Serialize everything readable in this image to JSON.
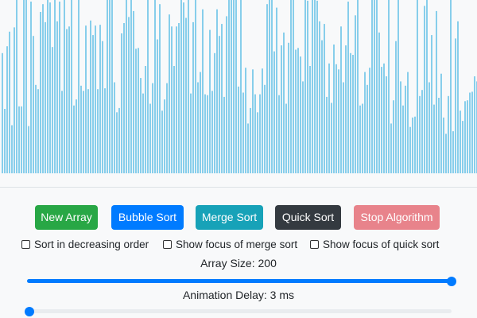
{
  "colors": {
    "bar": "#87ceeb",
    "new_array": "#28a745",
    "bubble_sort": "#007bff",
    "merge_sort": "#17a2b8",
    "quick_sort": "#343a40",
    "stop_algorithm": "#e8838b",
    "slider_fill": "#007bff",
    "slider_track": "#e9ecef"
  },
  "array": {
    "max_value": 200,
    "values": [
      140,
      75,
      148,
      165,
      56,
      170,
      216,
      78,
      78,
      216,
      216,
      55,
      200,
      160,
      103,
      98,
      188,
      197,
      176,
      217,
      199,
      147,
      216,
      177,
      200,
      96,
      213,
      168,
      171,
      214,
      79,
      86,
      216,
      102,
      96,
      172,
      98,
      178,
      161,
      172,
      98,
      173,
      154,
      99,
      216,
      216,
      203,
      106,
      71,
      76,
      163,
      175,
      216,
      182,
      204,
      189,
      145,
      146,
      111,
      93,
      125,
      213,
      81,
      105,
      208,
      156,
      197,
      73,
      86,
      105,
      185,
      171,
      125,
      171,
      175,
      208,
      199,
      181,
      212,
      93,
      176,
      215,
      106,
      118,
      191,
      92,
      91,
      167,
      96,
      140,
      191,
      160,
      174,
      89,
      183,
      205,
      216,
      216,
      213,
      101,
      216,
      94,
      123,
      58,
      76,
      121,
      92,
      71,
      92,
      122,
      103,
      197,
      213,
      204,
      142,
      193,
      91,
      149,
      164,
      81,
      152,
      216,
      204,
      144,
      146,
      136,
      107,
      203,
      201,
      125,
      205,
      216,
      201,
      177,
      155,
      174,
      89,
      128,
      82,
      150,
      127,
      121,
      171,
      106,
      149,
      200,
      140,
      138,
      184,
      203,
      79,
      81,
      118,
      103,
      123,
      203,
      214,
      207,
      164,
      124,
      128,
      113,
      216,
      58,
      85,
      154,
      216,
      107,
      79,
      102,
      118,
      54,
      65,
      66,
      209,
      90,
      97,
      195,
      204,
      106,
      161,
      80,
      189,
      88,
      116,
      65,
      46,
      90,
      216,
      49,
      157,
      177,
      73,
      61,
      84,
      85,
      94,
      95,
      113,
      107
    ]
  },
  "buttons": {
    "new_array": "New Array",
    "bubble_sort": "Bubble Sort",
    "merge_sort": "Merge Sort",
    "quick_sort": "Quick Sort",
    "stop_algorithm": "Stop Algorithm"
  },
  "options": {
    "decreasing": {
      "label": "Sort in decreasing order",
      "checked": false
    },
    "merge_focus": {
      "label": "Show focus of merge sort",
      "checked": false
    },
    "quick_focus": {
      "label": "Show focus of quick sort",
      "checked": false
    }
  },
  "array_size": {
    "label": "Array Size: 200",
    "value": 200,
    "min": 2,
    "max": 200,
    "fraction": 1.0
  },
  "animation_delay": {
    "label": "Animation Delay: 3 ms",
    "value": 3,
    "fraction": 0.0
  }
}
